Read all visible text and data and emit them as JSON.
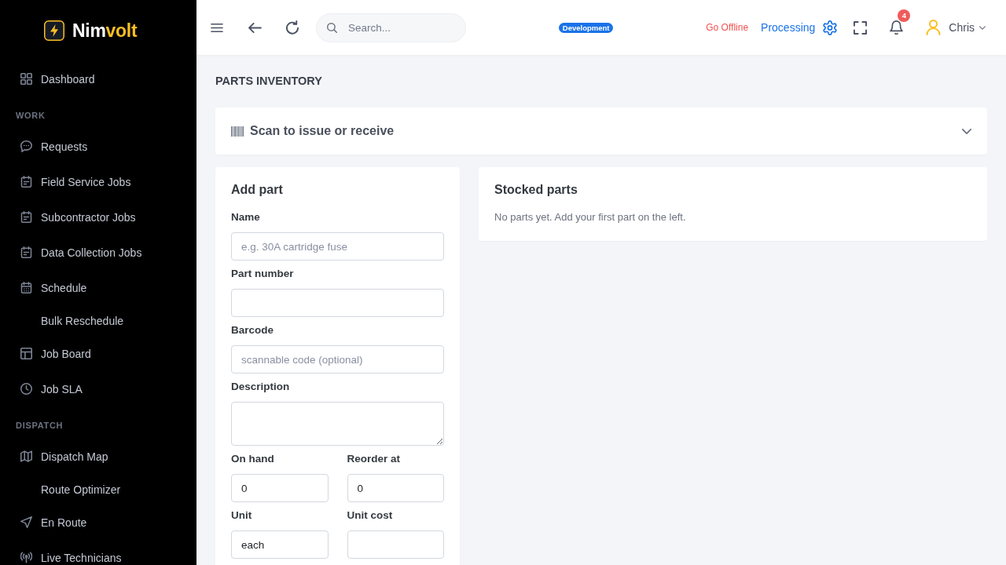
{
  "brand": {
    "name_main": "Nim",
    "name_accent": "volt"
  },
  "sidebar": {
    "sections": [
      {
        "items": [
          {
            "label": "Dashboard",
            "kind": "link",
            "selected": false
          }
        ]
      },
      {
        "title": "WORK",
        "items": [
          {
            "label": "Requests",
            "kind": "link",
            "selected": false
          },
          {
            "label": "Field Service Jobs",
            "kind": "link",
            "selected": false
          },
          {
            "label": "Subcontractor Jobs",
            "kind": "link",
            "selected": false
          },
          {
            "label": "Data Collection Jobs",
            "kind": "link",
            "selected": false
          },
          {
            "label": "Schedule",
            "kind": "link",
            "selected": false
          },
          {
            "label": "Bulk Reschedule",
            "kind": "sublink",
            "selected": false
          },
          {
            "label": "Job Board",
            "kind": "link",
            "selected": false
          },
          {
            "label": "Job SLA",
            "kind": "link",
            "selected": false
          }
        ]
      },
      {
        "title": "DISPATCH",
        "items": [
          {
            "label": "Dispatch Map",
            "kind": "link",
            "selected": false
          },
          {
            "label": "Route Optimizer",
            "kind": "sublink",
            "selected": false
          },
          {
            "label": "En Route",
            "kind": "link",
            "selected": false
          },
          {
            "label": "Live Technicians",
            "kind": "link",
            "selected": false
          }
        ]
      }
    ]
  },
  "topbar": {
    "search": {
      "placeholder": "Search..."
    },
    "environment": "Development",
    "offline_action": "Go Offline",
    "sync_status": "Processing",
    "notifications": {
      "count": "4"
    },
    "user": {
      "name": "Chris"
    }
  },
  "page": {
    "title": "PARTS INVENTORY"
  },
  "scan_panel": {
    "title": "Scan to issue or receive",
    "expanded": false
  },
  "add_part": {
    "title": "Add part",
    "rows": [
      {
        "fields": [
          {
            "label": "Name",
            "kind": "input",
            "placeholder": "e.g. 30A cartridge fuse"
          }
        ]
      },
      {
        "fields": [
          {
            "label": "Part number",
            "kind": "input"
          }
        ]
      },
      {
        "fields": [
          {
            "label": "Barcode",
            "kind": "input",
            "placeholder": "scannable code (optional)"
          }
        ]
      },
      {
        "fields": [
          {
            "label": "Description",
            "kind": "textarea"
          }
        ]
      },
      {
        "fields": [
          {
            "label": "On hand",
            "kind": "input",
            "value": "0"
          },
          {
            "label": "Reorder at",
            "kind": "input",
            "value": "0"
          }
        ]
      },
      {
        "fields": [
          {
            "label": "Unit",
            "kind": "input",
            "value": "each"
          },
          {
            "label": "Unit cost",
            "kind": "input"
          }
        ]
      }
    ]
  },
  "stocked_parts": {
    "title": "Stocked parts",
    "empty_message": "No parts yet. Add your first part on the left."
  }
}
